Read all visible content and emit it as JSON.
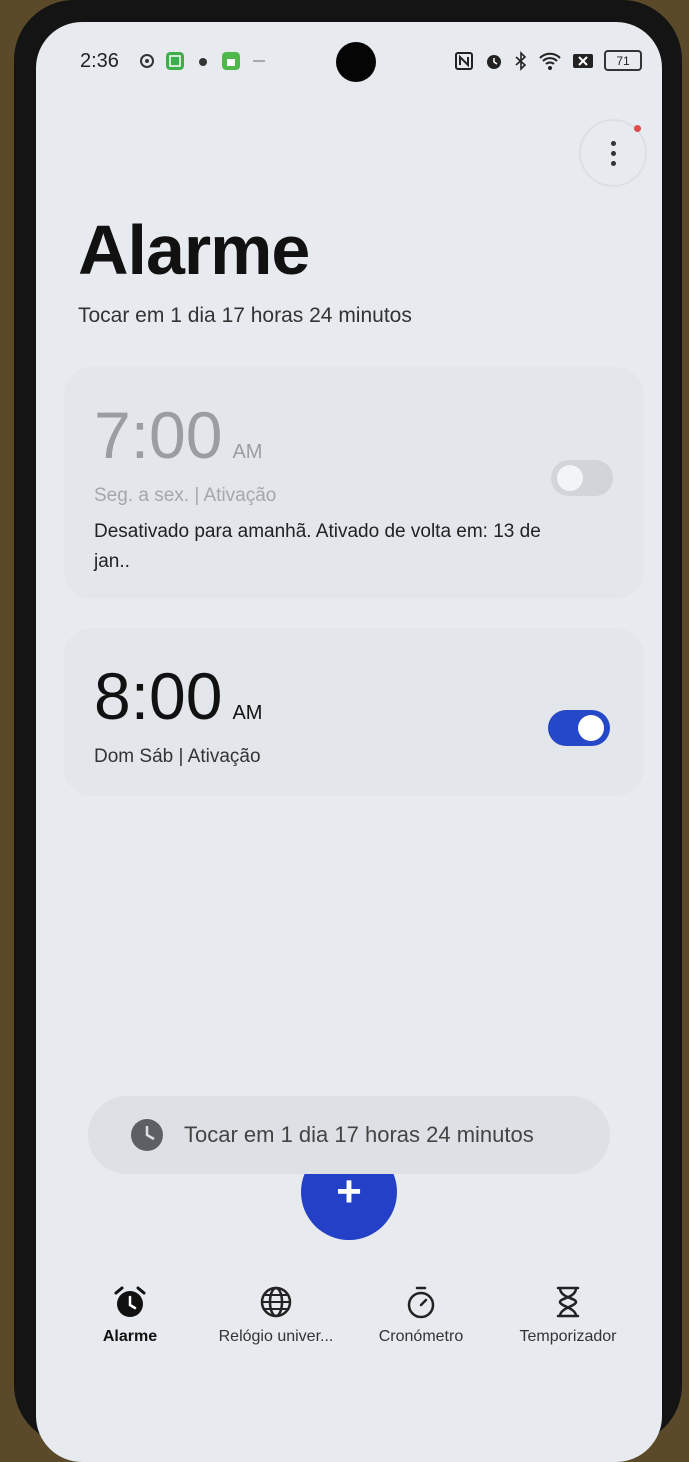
{
  "status_bar": {
    "time": "2:36",
    "battery": "71",
    "icons_left": [
      "settings-gear-icon",
      "green-app-icon",
      "small-app-icon",
      "green-square-icon",
      "dash-icon"
    ],
    "icons_right": [
      "nfc-icon",
      "alarm-icon",
      "bluetooth-icon",
      "wifi-icon",
      "x-box-icon",
      "battery-icon"
    ]
  },
  "header": {
    "title": "Alarme",
    "subtitle": "Tocar em 1 dia 17 horas 24 minutos"
  },
  "alarms": [
    {
      "time": "7:00",
      "ampm": "AM",
      "days": "Seg. a sex. | Ativação",
      "note": "Desativado para amanhã. Ativado de volta em: 13 de jan..",
      "enabled": false
    },
    {
      "time": "8:00",
      "ampm": "AM",
      "days": "Dom Sáb | Ativação",
      "enabled": true
    }
  ],
  "snackbar": {
    "text": "Tocar em 1 dia 17 horas 24 minutos"
  },
  "fab": {
    "label": "+"
  },
  "nav": [
    {
      "label": "Alarme",
      "icon": "alarm-clock-icon",
      "active": true
    },
    {
      "label": "Relógio univer...",
      "icon": "globe-icon",
      "active": false
    },
    {
      "label": "Cronómetro",
      "icon": "stopwatch-icon",
      "active": false
    },
    {
      "label": "Temporizador",
      "icon": "hourglass-icon",
      "active": false
    }
  ],
  "colors": {
    "accent": "#2340c6",
    "background": "#e7eaee",
    "card": "#e3e6ea",
    "notification_dot": "#e34a4a"
  }
}
